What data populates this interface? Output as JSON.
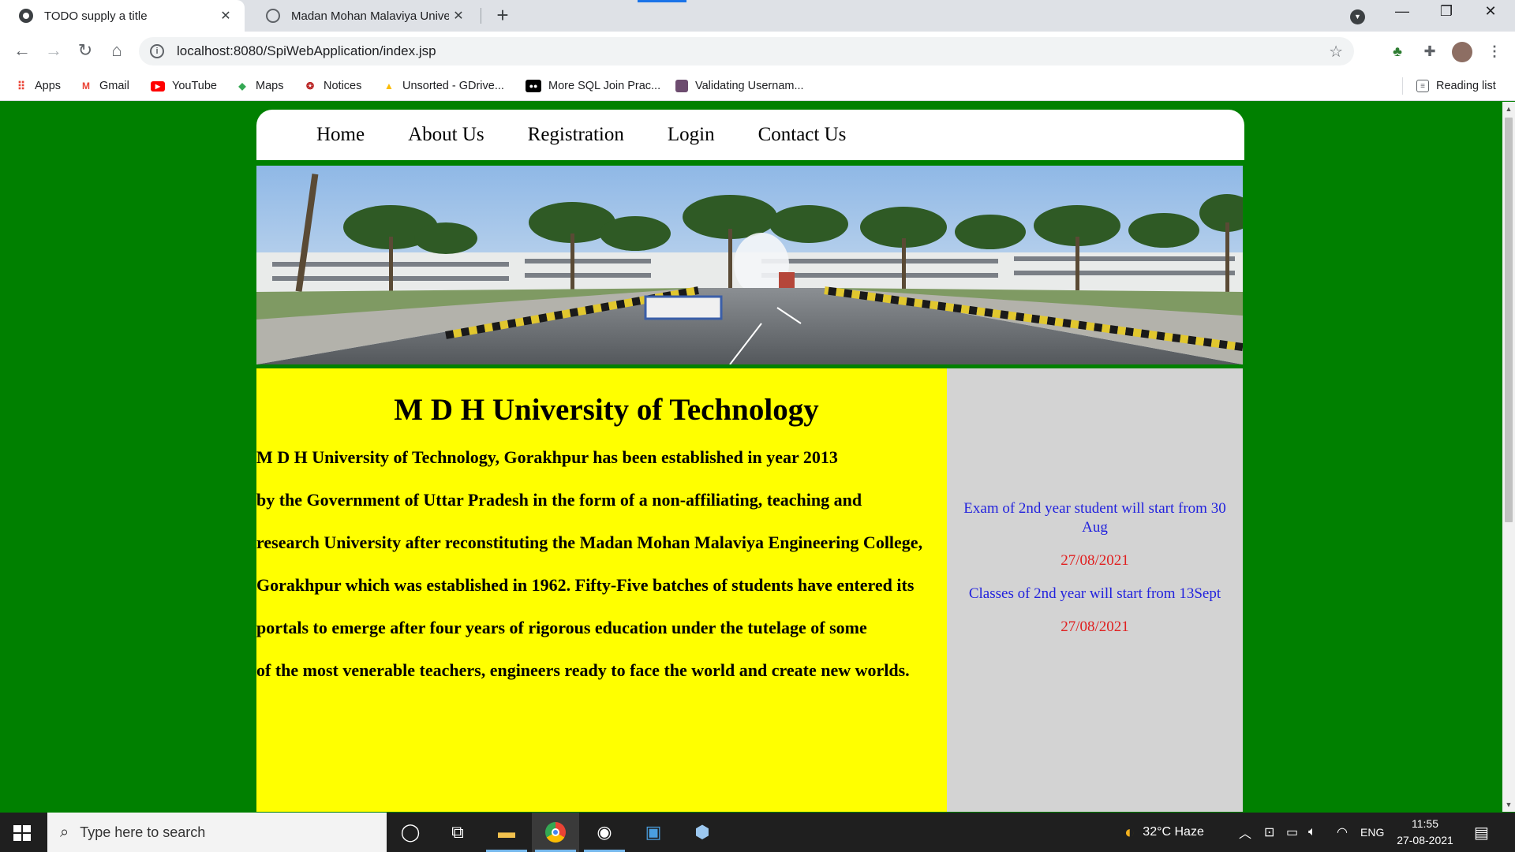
{
  "browser": {
    "tabs": [
      {
        "title": "TODO supply a title",
        "active": true
      },
      {
        "title": "Madan Mohan Malaviya University of Technology",
        "active": false
      }
    ],
    "new_tab": "+",
    "url": "localhost:8080/SpiWebApplication/index.jsp",
    "bookmarks": [
      "Apps",
      "Gmail",
      "YouTube",
      "Maps",
      "Notices",
      "Unsorted - GDrive...",
      "More SQL Join Prac...",
      "Validating Usernam..."
    ],
    "reading_list": "Reading list"
  },
  "site": {
    "menu": [
      "Home",
      "About Us",
      "Registration",
      "Login",
      "Contact Us"
    ],
    "heading": "M D H University of Technology",
    "paragraphs": [
      "M D H University of Technology, Gorakhpur has been established in year 2013",
      "by the Government of Uttar Pradesh in the form of a non-affiliating, teaching and",
      "research University after reconstituting the Madan Mohan Malaviya Engineering College,",
      "Gorakhpur which was established in 1962. Fifty-Five batches of students have entered its",
      "portals to emerge after four years of rigorous education under the tutelage of some",
      "of the most venerable teachers, engineers ready to face the world and create new worlds."
    ],
    "notices": [
      {
        "text": "Exam of 2nd year student will start from 30 Aug",
        "date": "27/08/2021"
      },
      {
        "text": "Classes of 2nd year will start from 13Sept",
        "date": "27/08/2021"
      }
    ],
    "colors": {
      "page_bg": "#008000",
      "main_bg": "#ffff00",
      "side_bg": "#d3d3d3",
      "notice": "#2222dd",
      "date": "#e02020"
    }
  },
  "taskbar": {
    "search_placeholder": "Type here to search",
    "weather": "32°C  Haze",
    "language": "ENG",
    "time": "11:55",
    "date": "27-08-2021"
  }
}
